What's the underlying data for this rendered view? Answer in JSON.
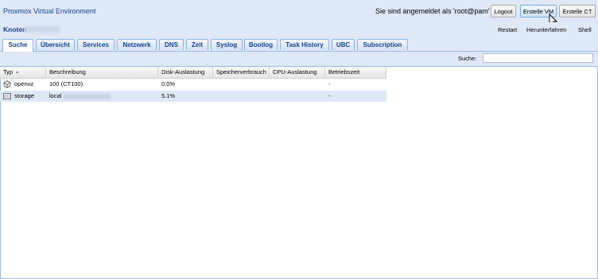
{
  "app": {
    "title": "Proxmox Virtual Environment"
  },
  "header": {
    "login_text": "Sie sind angemeldet als 'root@pam'",
    "logout_label": "Logout",
    "create_vm_label": "Erstelle VM",
    "create_ct_label": "Erstelle CT"
  },
  "node": {
    "label": "Knoten",
    "actions": {
      "restart": "Restart",
      "shutdown": "Herunterfahren",
      "shell": "Shell"
    }
  },
  "tabs": [
    "Suche",
    "Übersicht",
    "Services",
    "Netzwerk",
    "DNS",
    "Zeit",
    "Syslog",
    "Bootlog",
    "Task History",
    "UBC",
    "Subscription"
  ],
  "active_tab": "Suche",
  "search": {
    "label": "Suche:",
    "value": ""
  },
  "grid": {
    "columns": [
      "Typ",
      "Beschreibung",
      "Disk-Auslastung",
      "Speicherverbrauch",
      "CPU-Auslastung",
      "Betriebszeit"
    ],
    "sort_column": "Typ",
    "rows": [
      {
        "type": "openvz",
        "icon": "container-icon",
        "description": "100 (CT100)",
        "disk": "0.0%",
        "memory": "",
        "cpu": "",
        "uptime": "-"
      },
      {
        "type": "storage",
        "icon": "storage-icon",
        "description": "local",
        "disk": "5.1%",
        "memory": "",
        "cpu": "",
        "uptime": "-"
      }
    ]
  },
  "colors": {
    "accent": "#15428b",
    "panel": "#dfe8f6",
    "border": "#99bbe8"
  }
}
